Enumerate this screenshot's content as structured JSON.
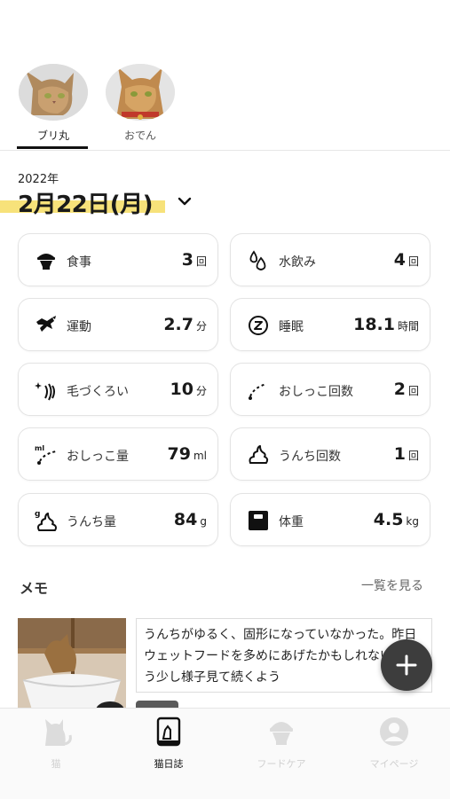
{
  "cats": [
    {
      "name": "ブリ丸",
      "selected": true
    },
    {
      "name": "おでん",
      "selected": false
    }
  ],
  "date": {
    "year": "2022年",
    "day": "2月22日(月)"
  },
  "stats": [
    {
      "label": "食事",
      "value": "3",
      "unit": "回",
      "icon": "food-bowl-icon"
    },
    {
      "label": "水飲み",
      "value": "4",
      "unit": "回",
      "icon": "water-drop-icon"
    },
    {
      "label": "運動",
      "value": "2.7",
      "unit": "分",
      "icon": "running-cat-icon"
    },
    {
      "label": "睡眠",
      "value": "18.1",
      "unit": "時間",
      "icon": "sleep-icon"
    },
    {
      "label": "毛づくろい",
      "value": "10",
      "unit": "分",
      "icon": "grooming-icon"
    },
    {
      "label": "おしっこ回数",
      "value": "2",
      "unit": "回",
      "icon": "pee-count-icon"
    },
    {
      "label": "おしっこ量",
      "value": "79",
      "unit": "ml",
      "icon": "pee-volume-icon",
      "icon_text": "ml"
    },
    {
      "label": "うんち回数",
      "value": "1",
      "unit": "回",
      "icon": "poop-count-icon"
    },
    {
      "label": "うんち量",
      "value": "84",
      "unit": "g",
      "icon": "poop-weight-icon",
      "icon_text": "g"
    },
    {
      "label": "体重",
      "value": "4.5",
      "unit": "kg",
      "icon": "weight-scale-icon"
    }
  ],
  "memo": {
    "title": "メモ",
    "view_all": "一覧を見る",
    "text": "うんちがゆるく、固形になっていなかった。昨日ウェットフードを多めにあげたかもしれない。もう少し様子見て続くよう"
  },
  "tabs": [
    {
      "label": "猫",
      "icon": "cat-icon",
      "active": false
    },
    {
      "label": "猫日誌",
      "icon": "diary-icon",
      "active": true
    },
    {
      "label": "フードケア",
      "icon": "food-care-icon",
      "active": false
    },
    {
      "label": "マイページ",
      "icon": "profile-icon",
      "active": false
    }
  ]
}
